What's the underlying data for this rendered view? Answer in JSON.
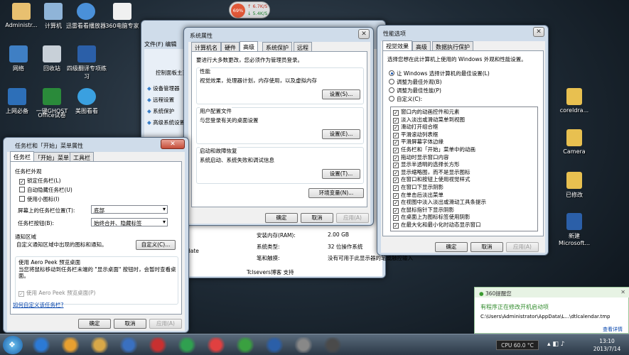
{
  "desktop": {
    "left_icons": [
      {
        "label": "Administr...",
        "color": "#e8c070"
      },
      {
        "label": "计算机",
        "color": "#8fb4d8"
      },
      {
        "label": "迅雷看看播放器",
        "color": "#4a90d9"
      },
      {
        "label": "360电脑专家",
        "color": "#f0f0f0"
      },
      {
        "label": "网络",
        "color": "#3f7fc4"
      },
      {
        "label": "回收站",
        "color": "#c8d0d8"
      },
      {
        "label": "四级翻译专项练习",
        "color": "#2b5fa8"
      },
      {
        "label": "上网必备",
        "color": "#2d6fb8"
      },
      {
        "label": "一键GHOST",
        "color": "#2a8a3a"
      },
      {
        "label": "美图看看",
        "color": "#3aa0e0"
      },
      {
        "label": "Office试卷",
        "color": "#2b5fa8"
      }
    ],
    "right_icons": [
      {
        "label": "coreldra...",
        "color": "#e8c050"
      },
      {
        "label": "Camera",
        "color": "#e8c050"
      },
      {
        "label": "已修改",
        "color": "#e8c050"
      },
      {
        "label": "新建Microsoft...",
        "color": "#2b5fa8"
      }
    ]
  },
  "widget": {
    "percent": "69%",
    "up": "6.7K/S",
    "down": "5.4K/S"
  },
  "explorer_behind": {
    "menu": [
      "文件(F)",
      "编辑"
    ],
    "side_links": [
      "控制面板主页",
      "设备管理器",
      "远程设置",
      "系统保护",
      "高级系统设置"
    ],
    "info_rows": [
      {
        "k": "安装内存(RAM):",
        "v": "2.00 GB"
      },
      {
        "k": "系统类型:",
        "v": "32 位操作系统"
      },
      {
        "k": "笔和触摸:",
        "v": "没有可用于此显示器的笔或触控输入"
      }
    ],
    "footer": "Tclsevers博客 支持",
    "update": "date"
  },
  "sysprop": {
    "title": "系统属性",
    "tabs": [
      "计算机名",
      "硬件",
      "高级",
      "系统保护",
      "远程"
    ],
    "admin_note": "要进行大多数更改，您必须作为管理员登录。",
    "perf_title": "性能",
    "perf_desc": "视觉效果，处理器计划，内存使用，以及虚拟内存",
    "profile_title": "用户配置文件",
    "profile_desc": "与您登录有关的桌面设置",
    "startup_title": "启动和故障恢复",
    "startup_desc": "系统启动、系统失败和调试信息",
    "settings_btn": "设置(S)...",
    "settings_btn2": "设置(E)...",
    "settings_btn3": "设置(T)...",
    "env_btn": "环境变量(N)...",
    "ok": "确定",
    "cancel": "取消",
    "apply": "应用(A)"
  },
  "perfopts": {
    "title": "性能选项",
    "tabs": [
      "视觉效果",
      "高级",
      "数据执行保护"
    ],
    "intro": "选择您想在此计算机上使用的 Windows 外观和性能设置。",
    "radios": [
      {
        "label": "让 Windows 选择计算机的最佳设置(L)",
        "on": true
      },
      {
        "label": "调整为最佳外观(B)",
        "on": false
      },
      {
        "label": "调整为最佳性能(P)",
        "on": false
      },
      {
        "label": "自定义(C):",
        "on": false
      }
    ],
    "effects": [
      "窗口内的动画控件和元素",
      "淡入淡出或滑动菜单到视图",
      "滑动打开组合框",
      "平滑滚动列表框",
      "平滑屏幕字体边缘",
      "任务栏和「开始」菜单中的动画",
      "拖动时显示窗口内容",
      "显示半透明的选择长方形",
      "显示缩略图，而不是显示图标",
      "在窗口和按钮上使用视觉样式",
      "在窗口下显示阴影",
      "在单击后淡出菜单",
      "在视图中淡入淡出或滑动工具条提示",
      "在鼠标指针下显示阴影",
      "在桌面上为图标标签使用阴影",
      "在最大化和最小化时动态显示窗口"
    ],
    "ok": "确定",
    "cancel": "取消",
    "apply": "应用(A)"
  },
  "taskbar_props": {
    "title": "任务栏和「开始」菜单属性",
    "tabs": [
      "任务栏",
      "「开始」菜单",
      "工具栏"
    ],
    "appearance": "任务栏外观",
    "checks": [
      {
        "label": "锁定任务栏(L)",
        "on": true
      },
      {
        "label": "自动隐藏任务栏(U)",
        "on": false
      },
      {
        "label": "使用小图标(I)",
        "on": false
      }
    ],
    "pos_label": "屏幕上的任务栏位置(T):",
    "pos_value": "底部",
    "btn_label": "任务栏按钮(B):",
    "btn_value": "始终合并、隐藏标签",
    "notify_title": "通知区域",
    "notify_desc": "自定义通知区域中出现的图标和通知。",
    "customize": "自定义(C)...",
    "peek_title": "使用 Aero Peek 预览桌面",
    "peek_desc": "当您将鼠标移动到任务栏末端的 \"显示桌面\" 按钮时，会暂时查看桌面。",
    "peek_check": "使用 Aero Peek 预览桌面(P)",
    "link": "如何自定义该任务栏?",
    "ok": "确定",
    "cancel": "取消",
    "apply": "应用(A)"
  },
  "toast": {
    "app": "360提醒您",
    "headline": "有程序正在修改开机启动项",
    "path": "C:\\Users\\Administrator\\AppData\\L...\\dtlcalendar.tmp",
    "link": "查看详情"
  },
  "tray": {
    "cpu": "CPU 60.0 °C",
    "time": "13:10",
    "date": "2013/7/14"
  },
  "taskbar_icons": [
    "#2c7ad6",
    "#e8a030",
    "#d8a848",
    "#3a70c0",
    "#c83030",
    "#30a050",
    "#e04040",
    "#3aa040",
    "#2b5fa8",
    "#888888",
    "#4a4a4a"
  ]
}
